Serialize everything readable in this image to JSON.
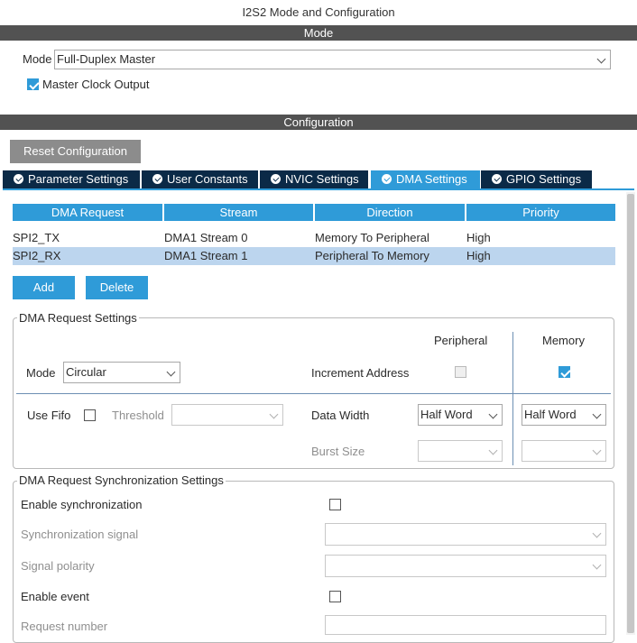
{
  "window": {
    "title": "I2S2 Mode and Configuration"
  },
  "mode_section": {
    "header": "Mode",
    "mode_label": "Mode",
    "mode_value": "Full-Duplex Master",
    "master_clock_label": "Master Clock Output",
    "master_clock_checked": true
  },
  "config_section": {
    "header": "Configuration",
    "reset_button": "Reset Configuration",
    "tabs": [
      {
        "label": "Parameter Settings",
        "active": false
      },
      {
        "label": "User Constants",
        "active": false
      },
      {
        "label": "NVIC Settings",
        "active": false
      },
      {
        "label": "DMA Settings",
        "active": true
      },
      {
        "label": "GPIO Settings",
        "active": false
      }
    ]
  },
  "dma_table": {
    "columns": [
      "DMA Request",
      "Stream",
      "Direction",
      "Priority"
    ],
    "rows": [
      [
        "SPI2_TX",
        "DMA1 Stream 0",
        "Memory To Peripheral",
        "High"
      ],
      [
        "SPI2_RX",
        "DMA1 Stream 1",
        "Peripheral To Memory",
        "High"
      ]
    ],
    "selected_row": 1,
    "add_button": "Add",
    "delete_button": "Delete"
  },
  "request_settings": {
    "title": "DMA Request Settings",
    "peripheral_header": "Peripheral",
    "memory_header": "Memory",
    "mode_label": "Mode",
    "mode_value": "Circular",
    "increment_label": "Increment Address",
    "peripheral_increment": false,
    "memory_increment": true,
    "use_fifo_label": "Use Fifo",
    "threshold_label": "Threshold",
    "threshold_value": "",
    "data_width_label": "Data Width",
    "peripheral_width": "Half Word",
    "memory_width": "Half Word",
    "burst_size_label": "Burst Size",
    "peripheral_burst": "",
    "memory_burst": ""
  },
  "sync_settings": {
    "title": "DMA Request Synchronization Settings",
    "enable_sync_label": "Enable synchronization",
    "sync_signal_label": "Synchronization signal",
    "signal_polarity_label": "Signal polarity",
    "enable_event_label": "Enable event",
    "request_number_label": "Request number"
  },
  "colors": {
    "accent": "#2f9bd8",
    "tab_dark": "#0b2a47",
    "section_bar": "#525252",
    "selected_row": "#bcd5ee"
  }
}
